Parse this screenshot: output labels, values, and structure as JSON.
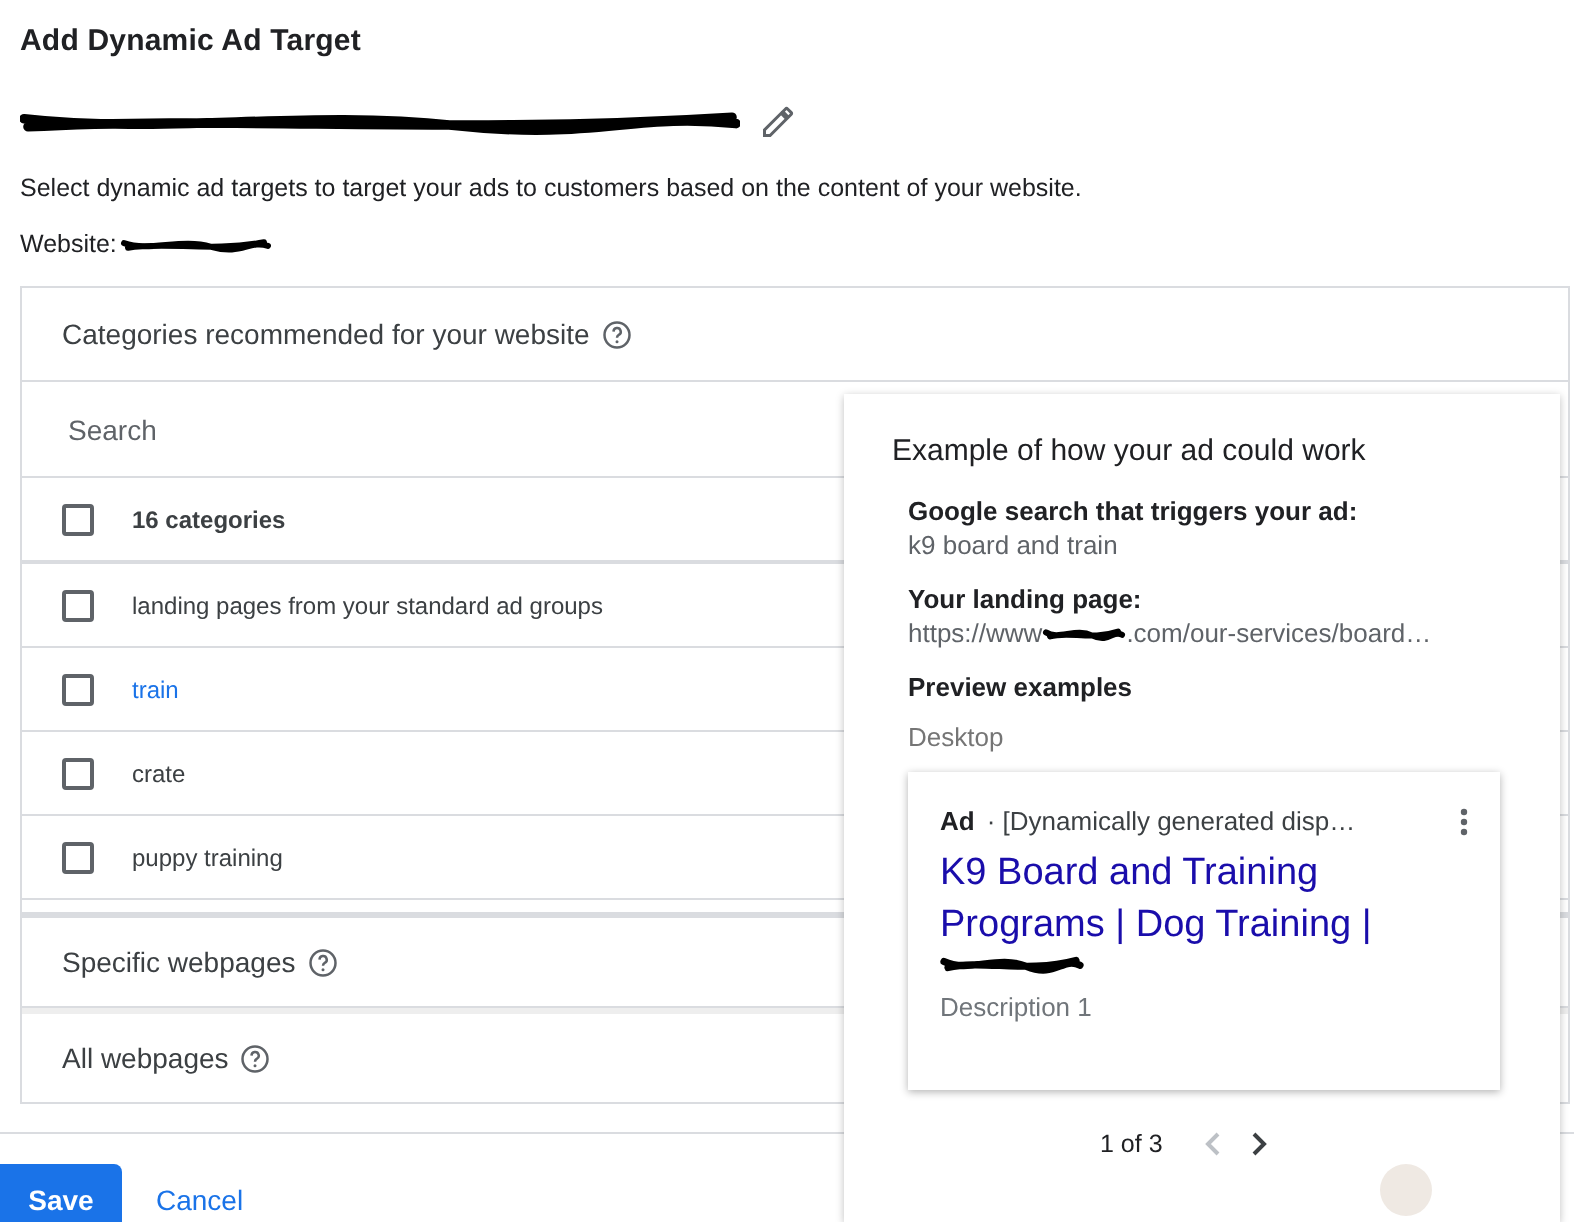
{
  "title": "Add Dynamic Ad Target",
  "description": "Select dynamic ad targets to target your ads to customers based on the content of your website.",
  "website_label": "Website:",
  "categories": {
    "heading": "Categories recommended for your website",
    "search": {
      "placeholder": "Search"
    },
    "select_all": {
      "label": "16 categories",
      "checked": false
    },
    "items": [
      {
        "label": "landing pages from your standard ad groups",
        "checked": false,
        "highlighted": false
      },
      {
        "label": "train",
        "checked": false,
        "highlighted": true
      },
      {
        "label": "crate",
        "checked": false,
        "highlighted": false
      },
      {
        "label": "puppy training",
        "checked": false,
        "highlighted": false
      }
    ]
  },
  "sections": [
    {
      "label": "Specific webpages"
    },
    {
      "label": "All webpages"
    }
  ],
  "preview": {
    "title": "Example of how your ad could work",
    "search_label": "Google search that triggers your ad:",
    "search_value": "k9 board and train",
    "landing_label": "Your landing page:",
    "landing_start": "https://www",
    "landing_end": ".com/our-services/board…",
    "examples_label": "Preview examples",
    "device": "Desktop",
    "ad": {
      "badge": "Ad",
      "display_url": "· [Dynamically generated disp…",
      "headline": "K9 Board and Training Programs | Dog Training |",
      "description": "Description 1"
    },
    "pager": {
      "text": "1 of 3",
      "prev_disabled": true,
      "next_disabled": false
    }
  },
  "buttons": {
    "save": "Save",
    "cancel": "Cancel"
  }
}
